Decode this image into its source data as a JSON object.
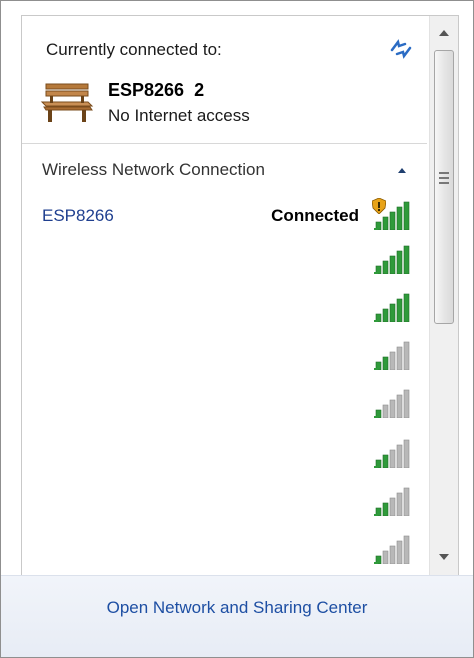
{
  "header": {
    "title": "Currently connected to:",
    "network_name": "ESP8266  2",
    "network_status": "No Internet access"
  },
  "section": {
    "title": "Wireless Network Connection"
  },
  "networks": [
    {
      "name": "ESP8266",
      "status": "Connected",
      "signal_bars": 5,
      "secured_warning": true
    },
    {
      "name": "",
      "status": "",
      "signal_bars": 5,
      "secured_warning": false
    },
    {
      "name": "",
      "status": "",
      "signal_bars": 5,
      "secured_warning": false
    },
    {
      "name": "",
      "status": "",
      "signal_bars": 2,
      "secured_warning": false
    },
    {
      "name": "",
      "status": "",
      "signal_bars": 1,
      "secured_warning": false
    },
    {
      "name": "",
      "status": "",
      "signal_bars": 2,
      "secured_warning": false
    },
    {
      "name": "",
      "status": "",
      "signal_bars": 2,
      "secured_warning": false
    },
    {
      "name": "",
      "status": "",
      "signal_bars": 1,
      "secured_warning": false
    }
  ],
  "footer": {
    "link": "Open Network and Sharing Center"
  },
  "colors": {
    "signal_active": "#2f9a3a",
    "signal_inactive": "#b8b8b8",
    "link": "#1e4fa3"
  }
}
